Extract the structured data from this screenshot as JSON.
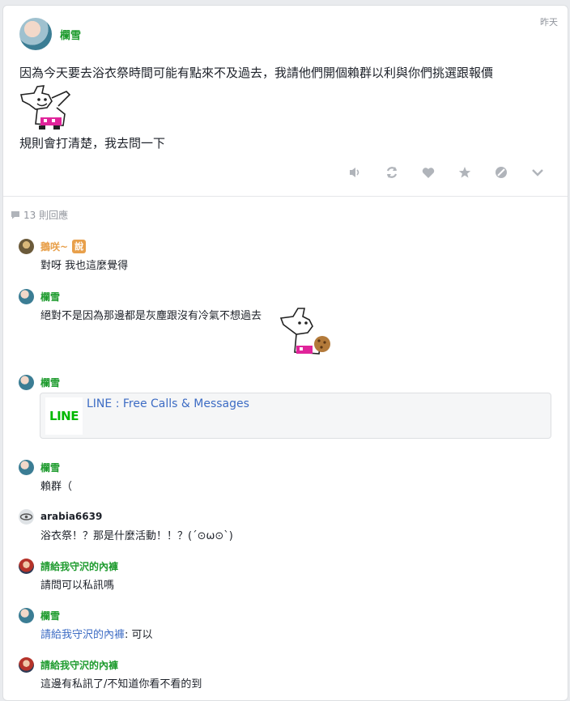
{
  "post": {
    "author": "欄雪",
    "timestamp": "昨天",
    "line1": "因為今天要去浴衣祭時間可能有點來不及過去，我請他們開個賴群以利與你們挑選跟報價",
    "line2": "規則會打清楚，我去問一下",
    "actions": [
      "mute-icon",
      "share-icon",
      "like-icon",
      "favorite-icon",
      "block-icon",
      "more-icon"
    ]
  },
  "replies": {
    "count_label": "13 則回應"
  },
  "comments": [
    {
      "author": "鵝咲~",
      "badge": "說",
      "text": "對呀 我也這麼覺得",
      "name_color": "#e8a04b"
    },
    {
      "author": "欄雪",
      "text": "絕對不是因為那邊都是灰塵跟沒有冷氣不想過去",
      "name_color": "#1e9b2e"
    },
    {
      "author": "欄雪",
      "link_logo": "LINE",
      "link_title": "LINE : Free Calls & Messages",
      "name_color": "#1e9b2e"
    },
    {
      "author": "欄雪",
      "text": "賴群（",
      "name_color": "#1e9b2e"
    },
    {
      "author": "arabia6639",
      "text": "浴衣祭！？那是什麼活動！！？(´⊙ω⊙`)",
      "name_color": "#1d2129"
    },
    {
      "author": "請給我守沢的內褲",
      "text": "請問可以私訊嗎",
      "name_color": "#1e9b2e"
    },
    {
      "author": "欄雪",
      "mention": "請給我守沢的內褲",
      "text": ": 可以",
      "name_color": "#1e9b2e"
    },
    {
      "author": "請給我守沢的內褲",
      "text": "這邊有私訊了/不知道你看不看的到",
      "name_color": "#1e9b2e"
    }
  ]
}
